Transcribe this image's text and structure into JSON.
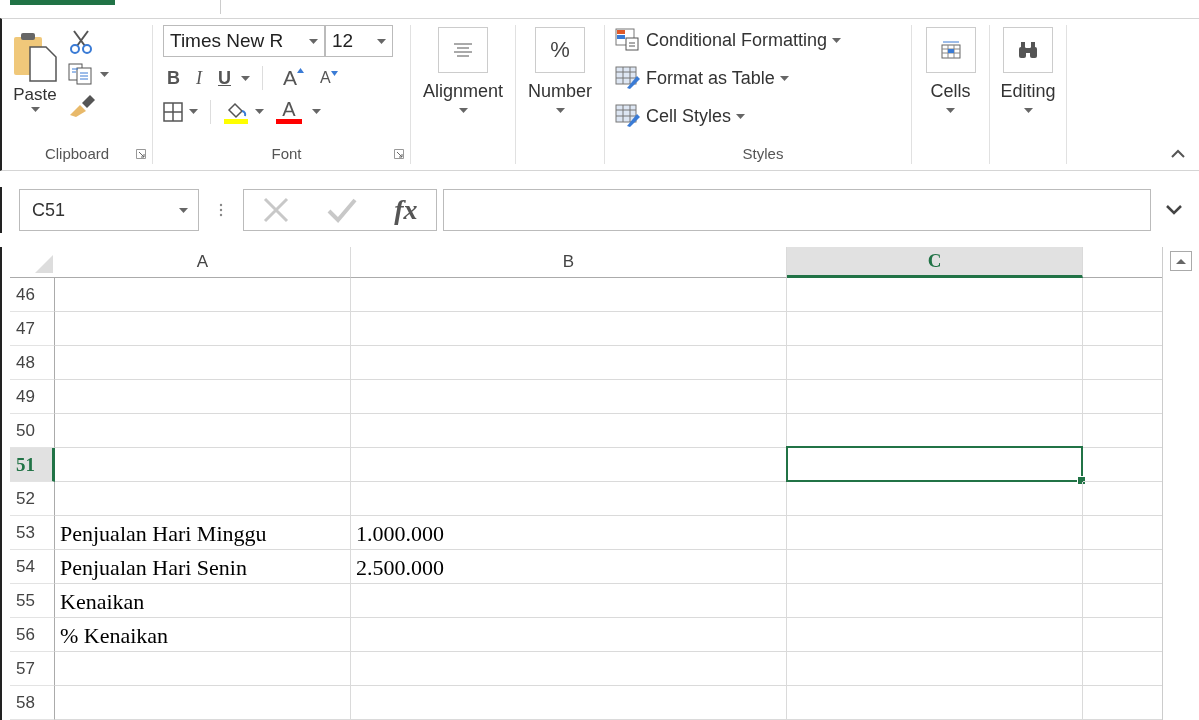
{
  "ribbon": {
    "clipboard": {
      "paste": "Paste",
      "label": "Clipboard"
    },
    "font": {
      "font_name": "Times New R",
      "font_size": "12",
      "bold": "B",
      "italic": "I",
      "underline": "U",
      "grow": "A",
      "shrink": "A",
      "font_color": "A",
      "label": "Font"
    },
    "alignment": {
      "label": "Alignment"
    },
    "number": {
      "symbol": "%",
      "label": "Number"
    },
    "styles": {
      "items": [
        "Conditional Formatting",
        "Format as Table",
        "Cell Styles"
      ],
      "label": "Styles"
    },
    "cells": {
      "label": "Cells"
    },
    "editing": {
      "label": "Editing"
    }
  },
  "formula_bar": {
    "name_box": "C51",
    "function_symbol": "fx"
  },
  "sheet": {
    "columns": [
      {
        "label": "A",
        "selected": false
      },
      {
        "label": "B",
        "selected": false
      },
      {
        "label": "C",
        "selected": true
      }
    ],
    "rows": [
      {
        "number": "46",
        "selected": false
      },
      {
        "number": "47",
        "selected": false
      },
      {
        "number": "48",
        "selected": false
      },
      {
        "number": "49",
        "selected": false
      },
      {
        "number": "50",
        "selected": false
      },
      {
        "number": "51",
        "selected": true
      },
      {
        "number": "52",
        "selected": false
      },
      {
        "number": "53",
        "selected": false,
        "cells": [
          "Penjualan Hari Minggu",
          "1.000.000"
        ]
      },
      {
        "number": "54",
        "selected": false,
        "cells": [
          "Penjualan Hari Senin",
          "2.500.000"
        ]
      },
      {
        "number": "55",
        "selected": false,
        "cells": [
          "Kenaikan"
        ]
      },
      {
        "number": "56",
        "selected": false,
        "cells": [
          "% Kenaikan"
        ]
      },
      {
        "number": "57",
        "selected": false
      },
      {
        "number": "58",
        "selected": false
      }
    ]
  }
}
